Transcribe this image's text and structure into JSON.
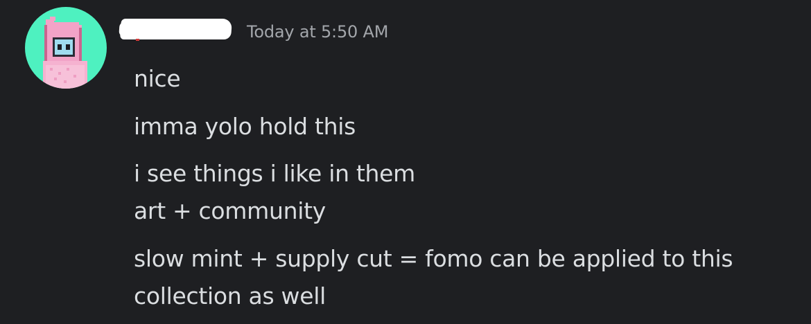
{
  "message": {
    "author": {
      "avatar_icon": "pink-hooded-pixel-character-icon",
      "avatar_bg": "#4ef1c0"
    },
    "timestamp": "Today at 5:50 AM",
    "lines": [
      "nice",
      "imma yolo hold this",
      "i see things i like in them",
      "art + community",
      "slow mint + supply cut = fomo can be applied to this",
      "collection as well"
    ]
  },
  "colors": {
    "background": "#1e1f22",
    "text": "#dbdee1",
    "timestamp": "#a3a6ab"
  }
}
